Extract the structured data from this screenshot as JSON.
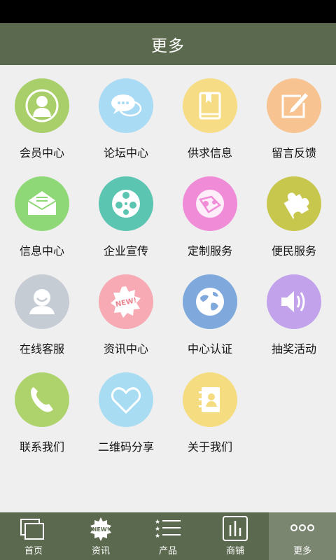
{
  "header": {
    "title": "更多"
  },
  "grid": {
    "items": [
      {
        "label": "会员中心",
        "icon": "member-icon",
        "color": "#a9cf6a"
      },
      {
        "label": "论坛中心",
        "icon": "chat-bubbles-icon",
        "color": "#a9dbf5"
      },
      {
        "label": "供求信息",
        "icon": "book-icon",
        "color": "#f6dd85"
      },
      {
        "label": "留言反馈",
        "icon": "edit-note-icon",
        "color": "#f7c391"
      },
      {
        "label": "信息中心",
        "icon": "envelope-icon",
        "color": "#8fd877"
      },
      {
        "label": "企业宣传",
        "icon": "film-reel-icon",
        "color": "#5bc5b2"
      },
      {
        "label": "定制服务",
        "icon": "custom-service-icon",
        "color": "#f08bd8"
      },
      {
        "label": "便民服务",
        "icon": "puzzle-icon",
        "color": "#c7c74e"
      },
      {
        "label": "在线客服",
        "icon": "support-agent-icon",
        "color": "#c6ccd4"
      },
      {
        "label": "资讯中心",
        "icon": "new-badge-icon",
        "color": "#f7a9b4"
      },
      {
        "label": "中心认证",
        "icon": "globe-icon",
        "color": "#7fa9dc"
      },
      {
        "label": "抽奖活动",
        "icon": "speaker-icon",
        "color": "#c3a2ec"
      },
      {
        "label": "联系我们",
        "icon": "phone-icon",
        "color": "#afd36c"
      },
      {
        "label": "二维码分享",
        "icon": "heart-icon",
        "color": "#a8dcf3"
      },
      {
        "label": "关于我们",
        "icon": "contact-book-icon",
        "color": "#f6dc80"
      }
    ]
  },
  "tabbar": {
    "items": [
      {
        "label": "首页",
        "icon": "home-windows-icon",
        "active": false
      },
      {
        "label": "资讯",
        "icon": "news-badge-icon",
        "active": false
      },
      {
        "label": "产品",
        "icon": "product-list-icon",
        "active": false
      },
      {
        "label": "商铺",
        "icon": "shop-chart-icon",
        "active": false
      },
      {
        "label": "更多",
        "icon": "more-dots-icon",
        "active": true
      }
    ]
  },
  "colors": {
    "header": "#5b6a4e",
    "tabbar": "#5b6a4e",
    "tab_active": "#7a8670",
    "background": "#efefef"
  }
}
